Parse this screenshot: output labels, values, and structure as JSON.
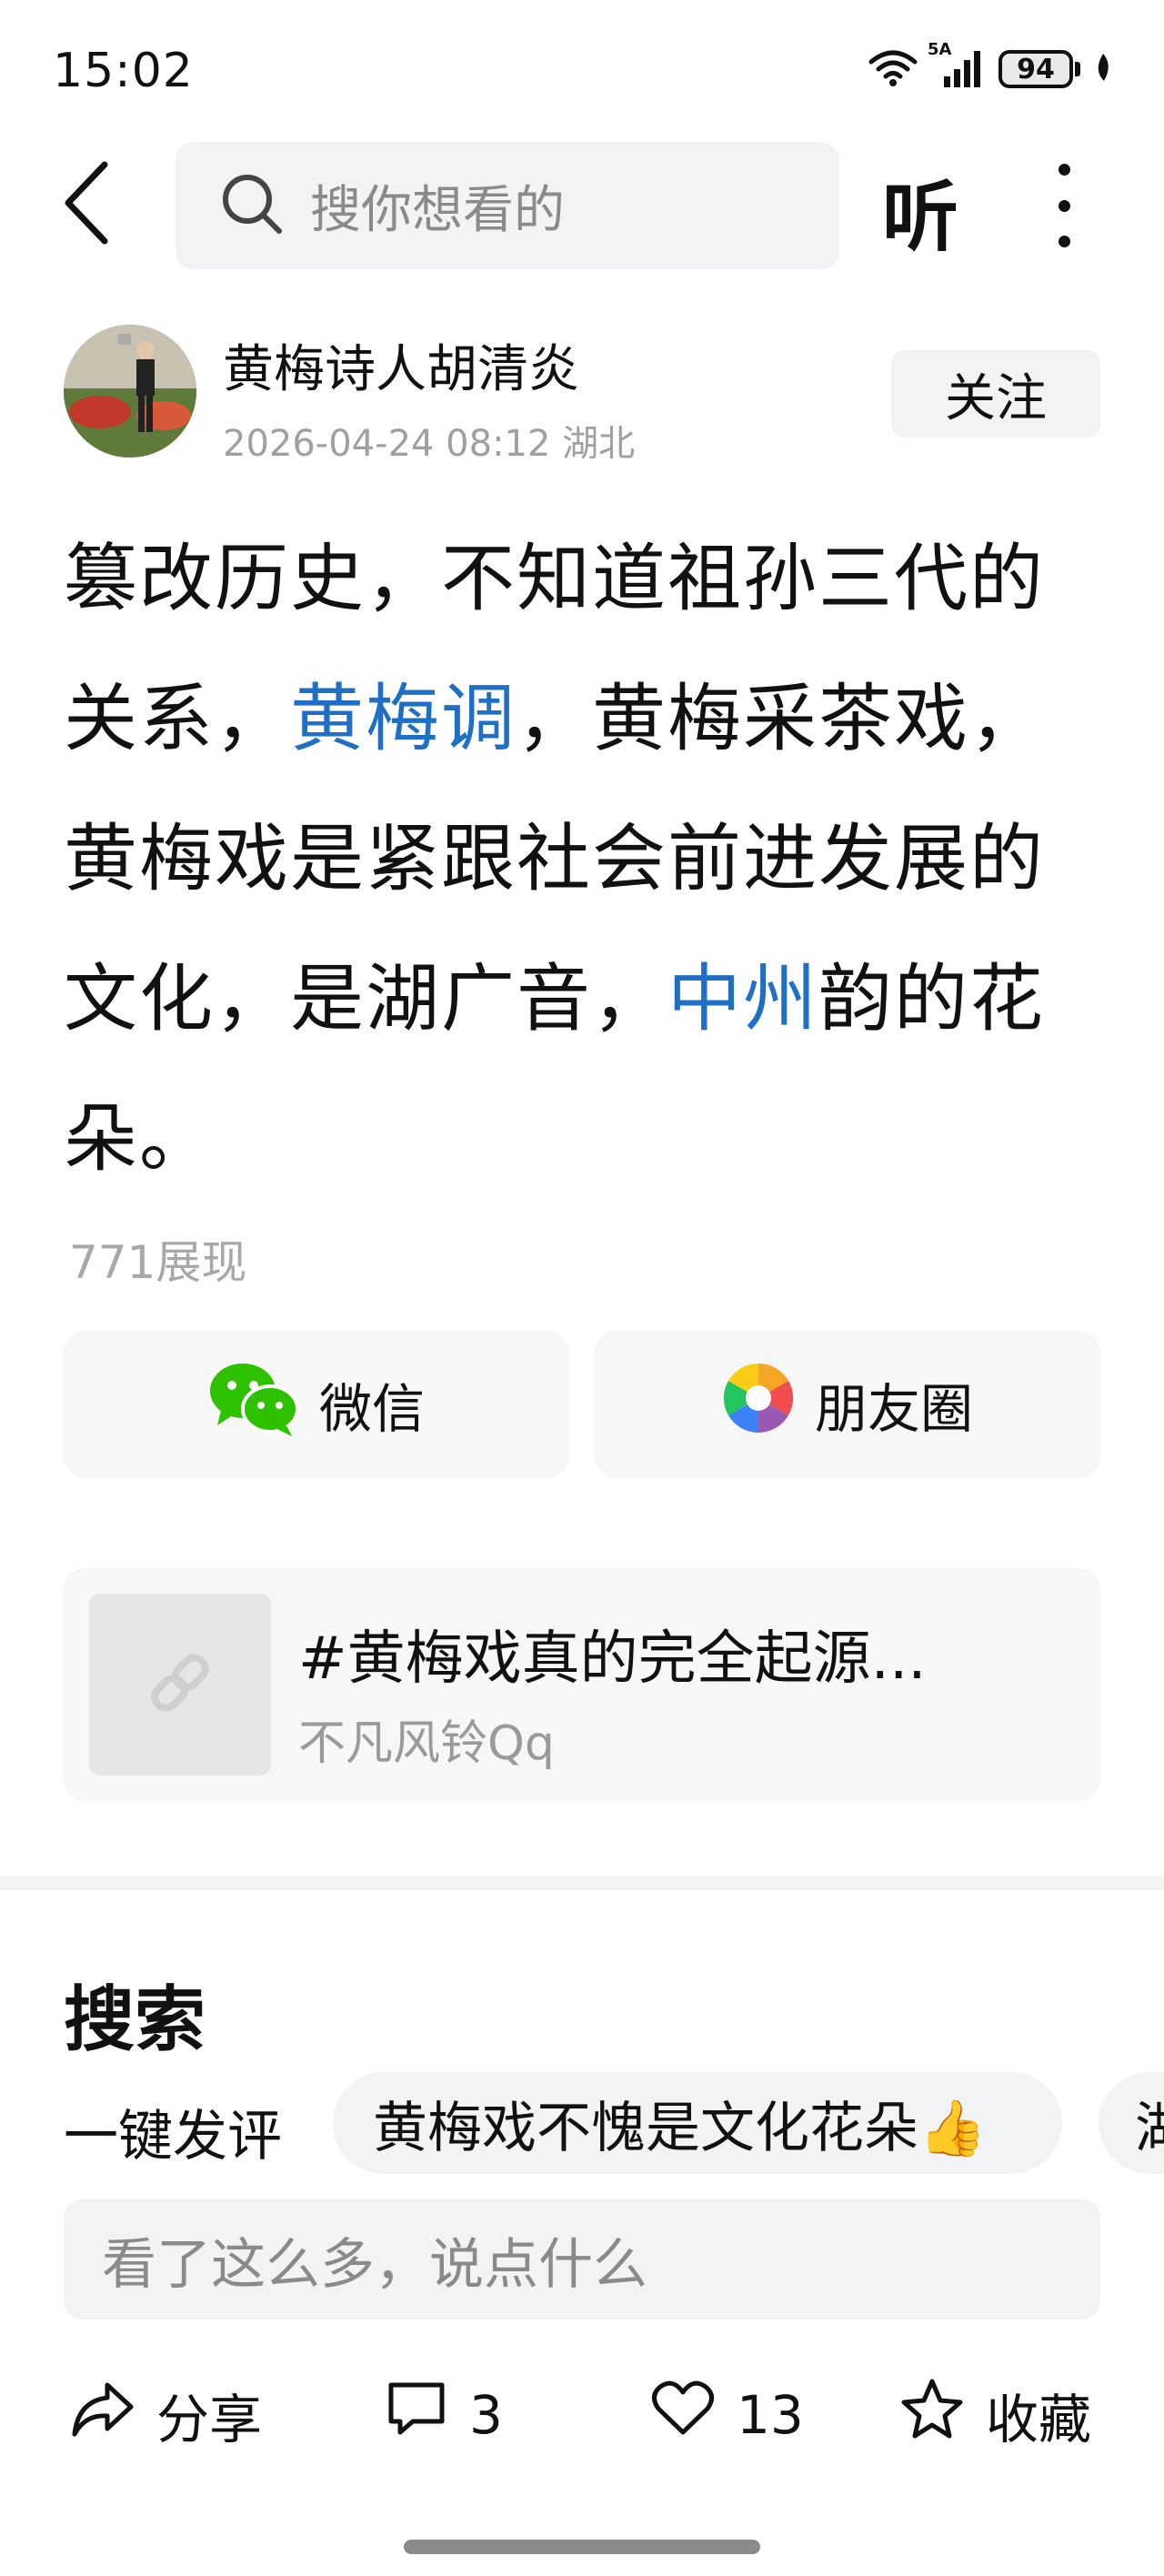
{
  "status_bar": {
    "time": "15:02",
    "network": "5A",
    "battery": "94"
  },
  "top_bar": {
    "search_placeholder": "搜你想看的",
    "listen_label": "听"
  },
  "author": {
    "name": "黄梅诗人胡清炎",
    "meta": "2026-04-24 08:12 湖北",
    "follow_label": "关注"
  },
  "post": {
    "segments": [
      "篡改历史，不知道祖孙三代的关系，",
      "黄梅调",
      "，黄梅采茶戏，黄梅戏是紧跟社会前进发展的文化，是湖广音，",
      "中州",
      "韵的花朵。"
    ],
    "views": "771展现"
  },
  "share": {
    "wechat_label": "微信",
    "moments_label": "朋友圈"
  },
  "topic_card": {
    "title": "#黄梅戏真的完全起源...",
    "author": "不凡风铃Qq"
  },
  "search_section": {
    "heading": "搜索",
    "quick_label": "一键发评",
    "chips": [
      "黄梅戏不愧是文化花朵👍",
      "湖"
    ]
  },
  "comment_input": {
    "placeholder": "看了这么多，说点什么"
  },
  "actions": {
    "share_label": "分享",
    "comment_count": "3",
    "like_count": "13",
    "favorite_label": "收藏"
  },
  "colors": {
    "link": "#1f6fc6",
    "wechat_green": "#2dc100",
    "muted_text": "#a0a0a0",
    "chip_bg": "#f2f3f5"
  }
}
